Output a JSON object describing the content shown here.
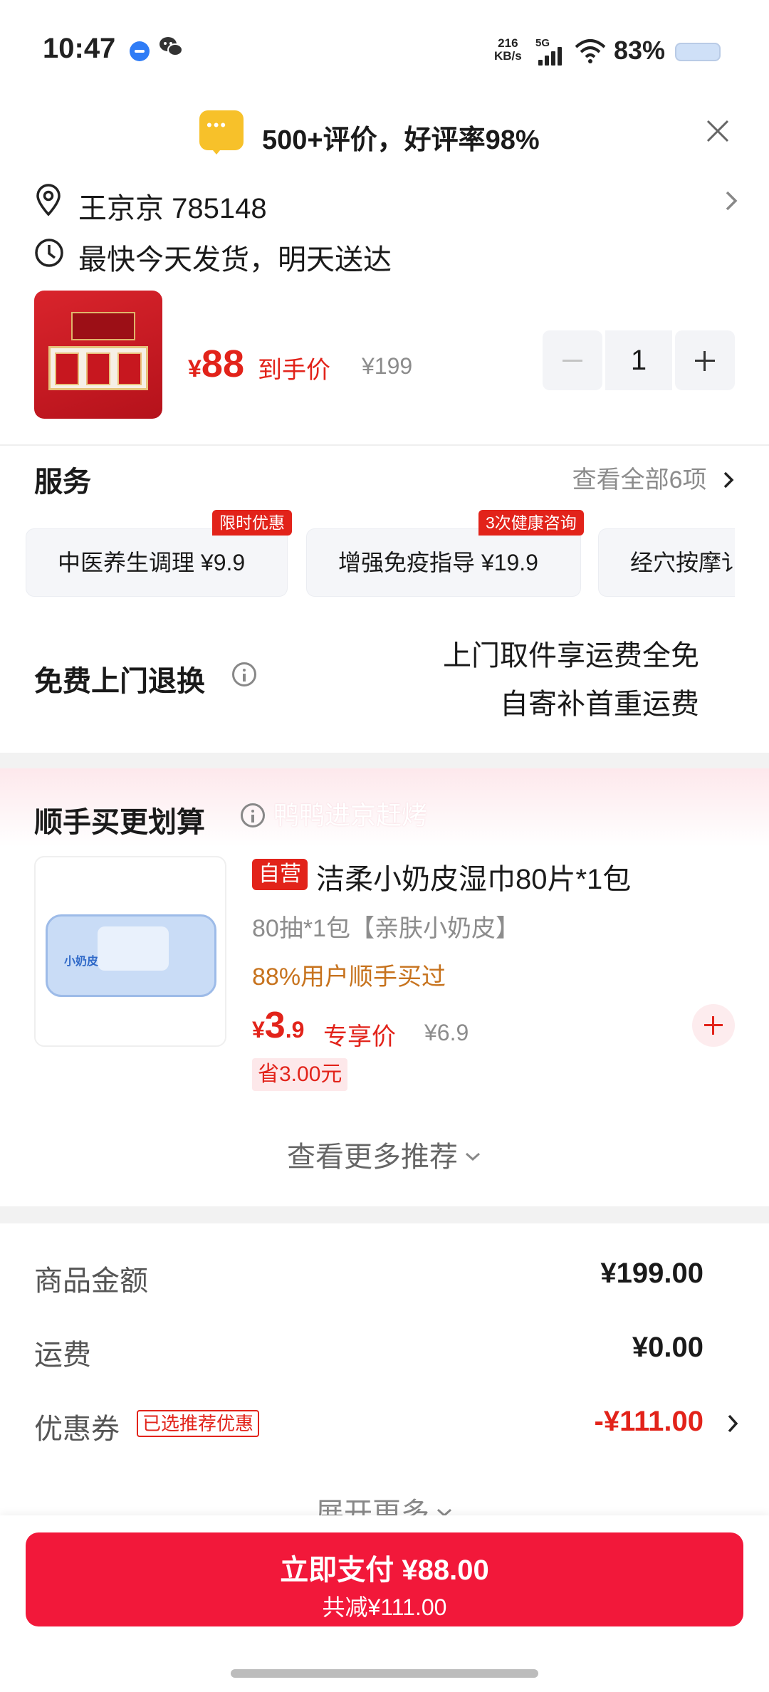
{
  "status_bar": {
    "time": "10:47",
    "net_speed_value": "216",
    "net_speed_unit": "KB/s",
    "network": "5G",
    "battery": "83%"
  },
  "banner": {
    "icon": "chat-bubble-icon",
    "review_text": "500+评价，好评率98%"
  },
  "address": {
    "text": "王京京  785148"
  },
  "shipping": {
    "text": "最快今天发货，明天送达"
  },
  "product": {
    "currency": "¥",
    "price": "88",
    "price_label": "到手价",
    "original_price": "¥199",
    "quantity": "1"
  },
  "services": {
    "title": "服务",
    "view_all": "查看全部6项",
    "items": [
      {
        "label": "中医养生调理  ¥9.9",
        "tag": "限时优惠"
      },
      {
        "label": "增强免疫指导  ¥19.9",
        "tag": "3次健康咨询"
      },
      {
        "label": "经穴按摩讠",
        "tag": ""
      }
    ]
  },
  "free_return": {
    "title": "免费上门退换",
    "line1": "上门取件享运费全免",
    "line2": "自寄补首重运费"
  },
  "upsell": {
    "title": "顺手买更划算",
    "watermark": "鸭鸭进京赶烤",
    "item": {
      "tag": "自营",
      "name": "洁柔小奶皮湿巾80片*1包",
      "spec": "80抽*1包【亲肤小奶皮】",
      "social_proof": "88%用户顺手买过",
      "currency": "¥",
      "price_int": "3",
      "price_dec": ".9",
      "price_label": "专享价",
      "original_price": "¥6.9",
      "saving": "省3.00元",
      "pack_logo": "小奶皮"
    },
    "more": "查看更多推荐"
  },
  "summary": {
    "goods_label": "商品金额",
    "goods_value": "¥199.00",
    "shipping_label": "运费",
    "shipping_value": "¥0.00",
    "coupon_label": "优惠券",
    "coupon_tag": "已选推荐优惠",
    "coupon_value": "-¥111.00",
    "expand": "展开更多"
  },
  "checkout": {
    "pay_label": "立即支付 ¥88.00",
    "discount_label": "共减¥111.00"
  },
  "colors": {
    "accent_red": "#e2231a",
    "pay_button": "#f2183a",
    "social_proof": "#c7731e"
  }
}
